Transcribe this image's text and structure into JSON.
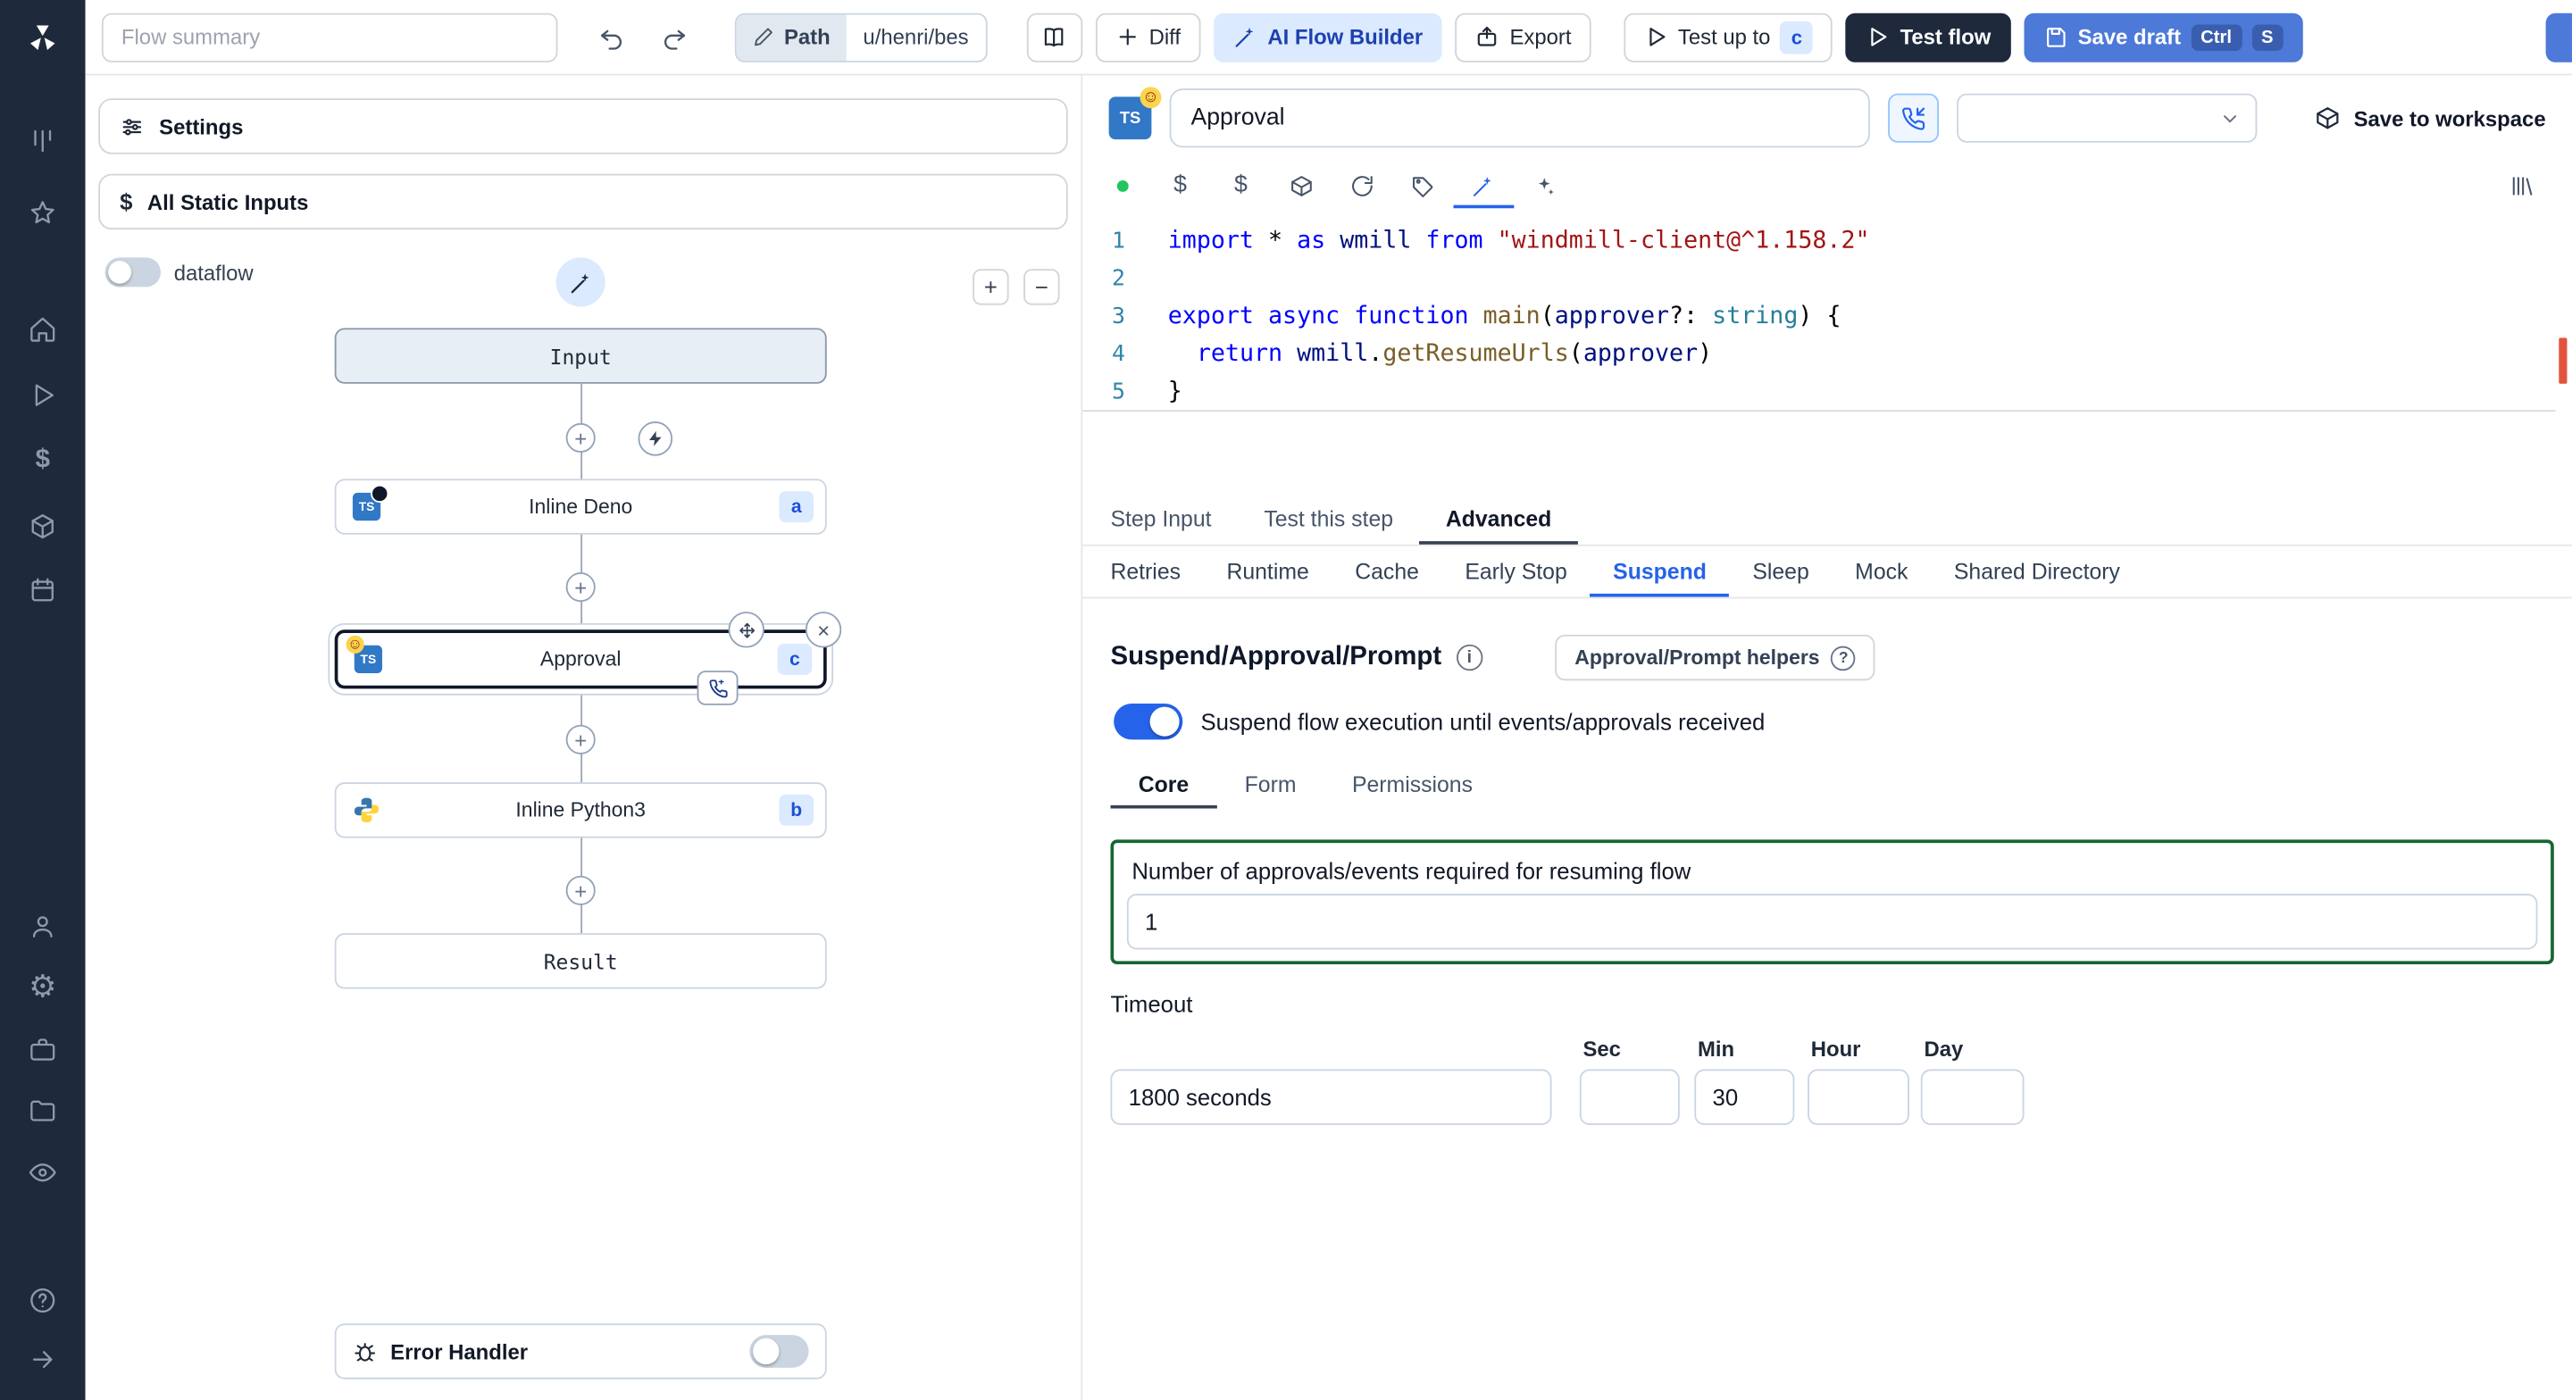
{
  "topbar": {
    "flow_summary": "Flow summary",
    "path_label": "Path",
    "path_value": "u/henri/bes",
    "diff": "Diff",
    "ai_flow_builder": "AI Flow Builder",
    "export": "Export",
    "test_up_to": "Test up to",
    "test_up_to_badge": "c",
    "test_flow": "Test flow",
    "save_draft": "Save draft",
    "kbd_ctrl": "Ctrl",
    "kbd_s": "S"
  },
  "icons": {
    "sidebar": [
      "windmill-logo",
      "kanban",
      "star",
      "home",
      "runs-play",
      "dollar",
      "resources-boxes",
      "calendar",
      "user",
      "gear",
      "briefcase",
      "folder",
      "eye",
      "help",
      "arrow-right"
    ],
    "editor_toolbar": [
      "green-status-dot",
      "dollar",
      "dollar",
      "package",
      "refresh",
      "tag",
      "wand",
      "sparkles",
      "library"
    ]
  },
  "flow_panel": {
    "settings": "Settings",
    "all_static_inputs": "All Static Inputs",
    "dataflow": "dataflow",
    "ts_label": "TS",
    "nodes": {
      "input": "Input",
      "deno": {
        "label": "Inline Deno",
        "badge": "a"
      },
      "approval": {
        "label": "Approval",
        "badge": "c"
      },
      "python": {
        "label": "Inline Python3",
        "badge": "b"
      },
      "result": "Result"
    },
    "error_handler": "Error Handler"
  },
  "step_panel": {
    "title": "Approval",
    "save_to_workspace": "Save to workspace",
    "tabs": [
      "Step Input",
      "Test this step",
      "Advanced"
    ],
    "advanced_tabs": [
      "Retries",
      "Runtime",
      "Cache",
      "Early Stop",
      "Suspend",
      "Sleep",
      "Mock",
      "Shared Directory"
    ],
    "suspend": {
      "heading": "Suspend/Approval/Prompt",
      "helpers": "Approval/Prompt helpers",
      "toggle_label": "Suspend flow execution until events/approvals received",
      "tabs": [
        "Core",
        "Form",
        "Permissions"
      ],
      "approvals_label": "Number of approvals/events required for resuming flow",
      "approvals_value": "1",
      "timeout_label": "Timeout",
      "timeout_value": "1800 seconds",
      "unit_labels": [
        "Sec",
        "Min",
        "Hour",
        "Day"
      ],
      "min_value": "30"
    }
  },
  "code": {
    "lines": [
      {
        "n": "1",
        "tokens": [
          [
            "kw",
            "import"
          ],
          [
            "pl",
            " * "
          ],
          [
            "kw",
            "as"
          ],
          [
            "id",
            " wmill "
          ],
          [
            "kw",
            "from"
          ],
          [
            "pl",
            " "
          ],
          [
            "str",
            "\"windmill-client@^1.158.2\""
          ]
        ]
      },
      {
        "n": "2",
        "tokens": []
      },
      {
        "n": "3",
        "tokens": [
          [
            "kw",
            "export"
          ],
          [
            "pl",
            " "
          ],
          [
            "kw",
            "async"
          ],
          [
            "pl",
            " "
          ],
          [
            "kw",
            "function"
          ],
          [
            "pl",
            " "
          ],
          [
            "fn",
            "main"
          ],
          [
            "pl",
            "("
          ],
          [
            "id",
            "approver"
          ],
          [
            "pl",
            "?: "
          ],
          [
            "ty",
            "string"
          ],
          [
            "pl",
            ") {"
          ]
        ]
      },
      {
        "n": "4",
        "tokens": [
          [
            "pl",
            "  "
          ],
          [
            "kw",
            "return"
          ],
          [
            "pl",
            " "
          ],
          [
            "id",
            "wmill"
          ],
          [
            "pl",
            "."
          ],
          [
            "fn",
            "getResumeUrls"
          ],
          [
            "pl",
            "("
          ],
          [
            "id",
            "approver"
          ],
          [
            "pl",
            ")"
          ]
        ]
      },
      {
        "n": "5",
        "tokens": [
          [
            "pl",
            "}"
          ]
        ]
      }
    ]
  }
}
